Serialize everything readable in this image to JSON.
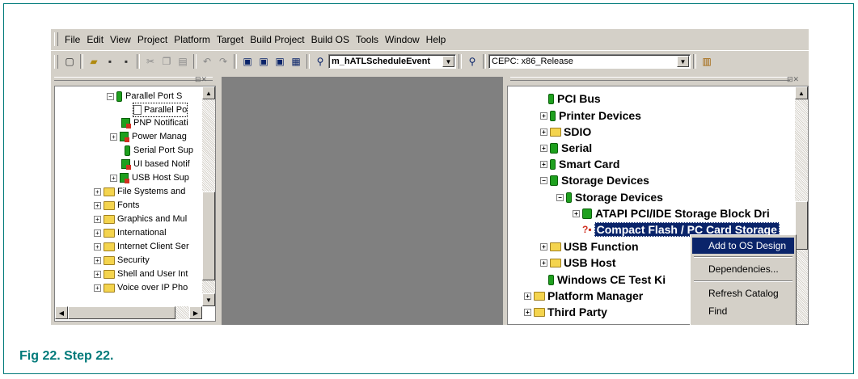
{
  "menubar": {
    "items": [
      "File",
      "Edit",
      "View",
      "Project",
      "Platform",
      "Target",
      "Build Project",
      "Build OS",
      "Tools",
      "Window",
      "Help"
    ]
  },
  "toolbar": {
    "function_combo": "m_hATLScheduleEvent",
    "config_combo": "CEPC: x86_Release"
  },
  "left_tree": {
    "items": [
      {
        "label": "Parallel Port S",
        "icon": "component-green"
      },
      {
        "label": "Parallel Po",
        "icon": "page"
      },
      {
        "label": "PNP Notificati",
        "icon": "component-red"
      },
      {
        "label": "Power Manag",
        "icon": "component-red"
      },
      {
        "label": "Serial Port Sup",
        "icon": "component-green"
      },
      {
        "label": "UI based Notif",
        "icon": "component-red"
      },
      {
        "label": "USB Host Sup",
        "icon": "component-red"
      },
      {
        "label": "File Systems and",
        "icon": "folder"
      },
      {
        "label": "Fonts",
        "icon": "folder"
      },
      {
        "label": "Graphics and Mul",
        "icon": "folder"
      },
      {
        "label": "International",
        "icon": "folder"
      },
      {
        "label": "Internet Client Ser",
        "icon": "folder"
      },
      {
        "label": "Security",
        "icon": "folder"
      },
      {
        "label": "Shell and User Int",
        "icon": "folder"
      },
      {
        "label": "Voice over IP Pho",
        "icon": "folder"
      }
    ]
  },
  "right_tree": {
    "items": [
      {
        "label": "PCI Bus"
      },
      {
        "label": "Printer Devices"
      },
      {
        "label": "SDIO"
      },
      {
        "label": "Serial"
      },
      {
        "label": "Smart Card"
      },
      {
        "label": "Storage Devices"
      },
      {
        "label": "Storage Devices"
      },
      {
        "label": "ATAPI PCI/IDE Storage Block Dri"
      },
      {
        "label": "Compact Flash / PC Card Storage"
      },
      {
        "label": "USB Function"
      },
      {
        "label": "USB Host"
      },
      {
        "label": "Windows CE Test Ki"
      },
      {
        "label": "Platform Manager"
      },
      {
        "label": "Third Party"
      }
    ]
  },
  "context_menu": {
    "items": [
      "Add to OS Design",
      "Dependencies...",
      "Refresh Catalog",
      "Find"
    ]
  },
  "caption": "Fig 22.  Step 22.",
  "colors": {
    "accent": "#007a7a",
    "selection": "#0a246a",
    "window": "#d4d0c8"
  }
}
